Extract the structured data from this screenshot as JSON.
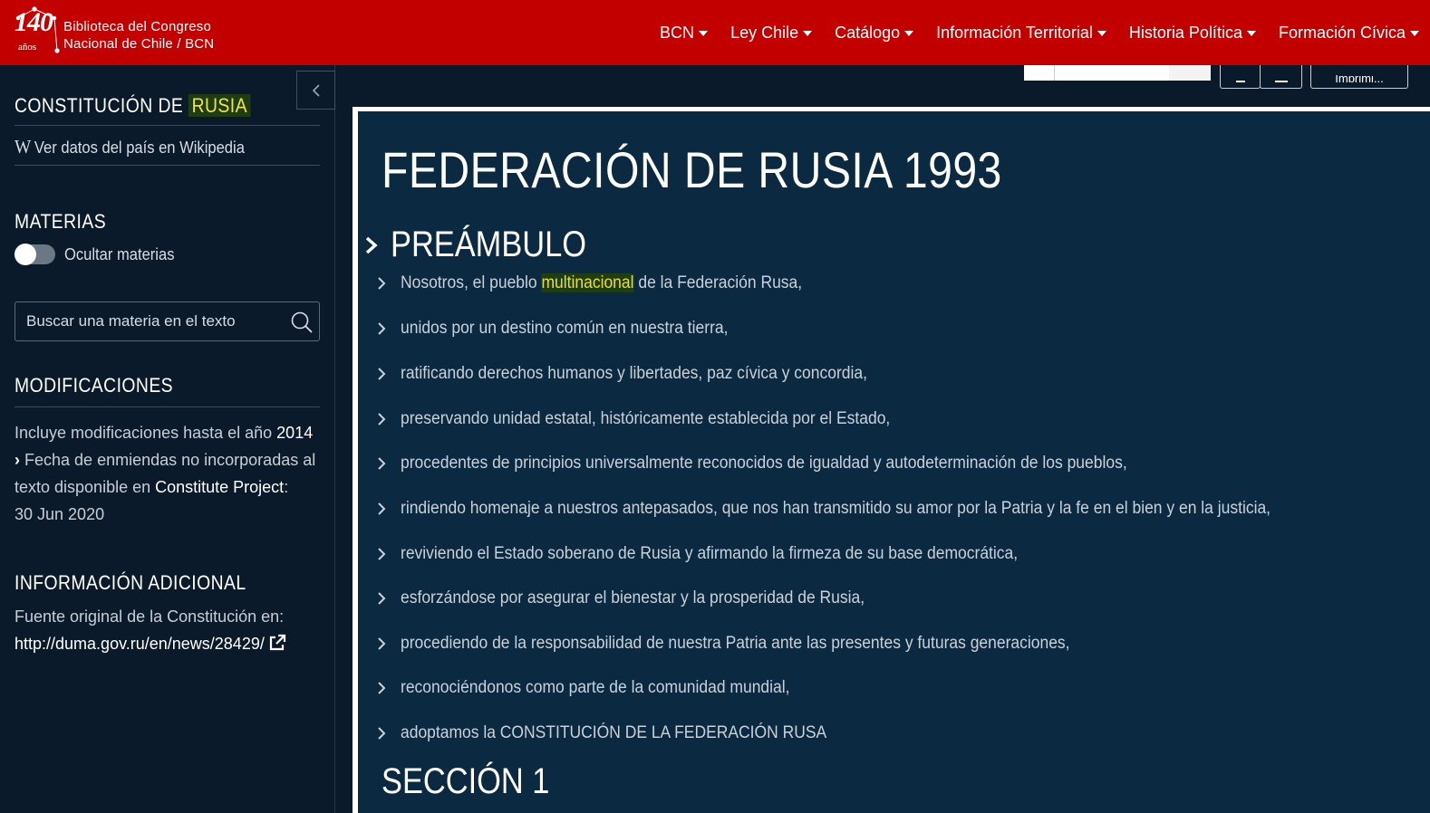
{
  "header": {
    "logo": {
      "number": "140",
      "years": "años",
      "line1": "Biblioteca del Congreso",
      "line2": "Nacional de Chile / BCN"
    },
    "nav": [
      "BCN",
      "Ley Chile",
      "Catálogo",
      "Información Territorial",
      "Historia Política",
      "Formación Cívica"
    ],
    "brand_color": "#c20000"
  },
  "sidebar": {
    "title_prefix": "CONSTITUCIÓN DE ",
    "title_country": "RUSIA",
    "wiki_glyph": "W",
    "wiki_link": "Ver datos del país en Wikipedia",
    "materias_heading": "MATERIAS",
    "toggle_label": "Ocultar materias",
    "toggle_on": false,
    "search_placeholder": "Buscar una materia en el texto",
    "mods_heading": "MODIFICACIONES",
    "mods_text_1": "Incluye modificaciones hasta el año ",
    "mods_year": "2014",
    "mods_text_2": "Fecha de enmiendas no incorporadas al texto disponible en ",
    "mods_source": "Constitute Project",
    "mods_colon": ":",
    "mods_date": "30 Jun 2020",
    "info_heading": "INFORMACIÓN ADICIONAL",
    "info_text": "Fuente original de la Constitución en:",
    "info_url": "http://duma.gov.ru/en/news/28429/"
  },
  "toolbar": {
    "print_label": "Imprimi..."
  },
  "document": {
    "title": "FEDERACIÓN DE RUSIA 1993",
    "section_heading": "PREÁMBULO",
    "p0_pre": "Nosotros, el pueblo ",
    "p0_hl": "multinacional",
    "p0_post": " de la Federación Rusa,",
    "paragraphs": [
      "unidos por un destino común en nuestra tierra,",
      "ratificando derechos humanos y libertades, paz cívica y concordia,",
      "preservando unidad estatal, históricamente establecida por el Estado,",
      "procedentes de principios universalmente reconocidos de igualdad y autodeterminación de los pueblos,",
      "rindiendo homenaje a nuestros antepasados, que nos han transmitido su amor por la Patria y la fe en el bien y en la justicia,",
      "reviviendo el Estado soberano de Rusia y afirmando la firmeza de su base democrática,",
      "esforzándose por asegurar el bienestar y la prosperidad de Rusia,",
      "procediendo de la responsabilidad de nuestra Patria ante las presentes y futuras generaciones,",
      "reconociéndonos como parte de la comunidad mundial,",
      "adoptamos la CONSTITUCIÓN DE LA FEDERACIÓN RUSA"
    ],
    "next_section": "SECCIÓN 1"
  }
}
